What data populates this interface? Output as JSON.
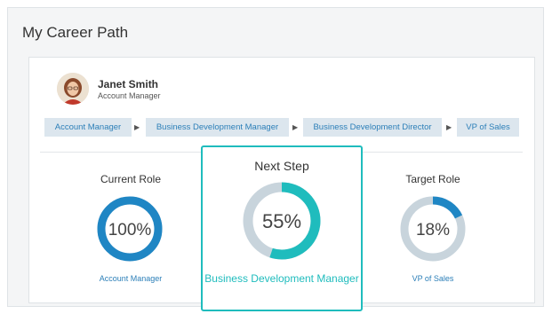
{
  "page_title": "My Career Path",
  "user": {
    "name": "Janet Smith",
    "role": "Account Manager"
  },
  "path": [
    {
      "label": "Account Manager"
    },
    {
      "label": "Business Development Manager"
    },
    {
      "label": "Business Development Director"
    },
    {
      "label": "VP of Sales"
    }
  ],
  "roles": {
    "current": {
      "heading": "Current Role",
      "percent_label": "100%",
      "percent": 100,
      "link": "Account Manager"
    },
    "next": {
      "heading": "Next Step",
      "percent_label": "55%",
      "percent": 55,
      "link": "Business Development Manager"
    },
    "target": {
      "heading": "Target Role",
      "percent_label": "18%",
      "percent": 18,
      "link": "VP of Sales"
    }
  },
  "colors": {
    "accent_blue": "#2c7fb8",
    "donut_blue": "#1f86c4",
    "accent_teal": "#1fbcbd",
    "track": "#c8d4dc"
  }
}
